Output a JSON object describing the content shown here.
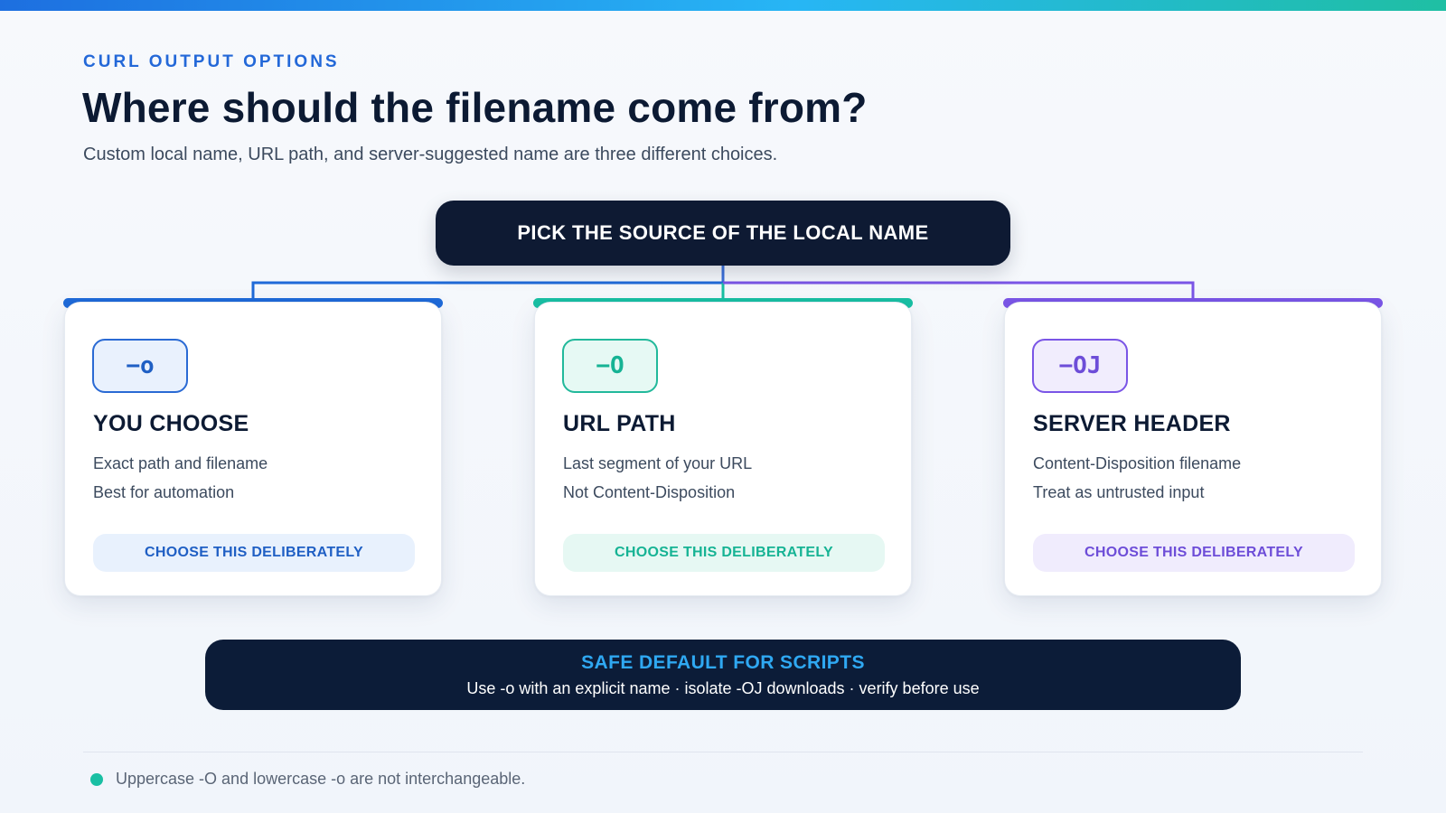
{
  "header": {
    "eyebrow": "CURL OUTPUT OPTIONS",
    "title": "Where should the filename come from?",
    "subtitle": "Custom local name, URL path, and server-suggested name are three different choices."
  },
  "root": {
    "label": "PICK THE SOURCE OF THE LOCAL NAME"
  },
  "cards": [
    {
      "flag": "−o",
      "title": "YOU CHOOSE",
      "lines": [
        "Exact path and filename",
        "Best for automation"
      ],
      "button": "CHOOSE THIS DELIBERATELY",
      "accent": "#1f6ad8",
      "badge_bg": "#e9f1fd",
      "badge_text": "#1f5fc4",
      "button_bg": "#e8f1fd",
      "button_text": "#1f5fc4"
    },
    {
      "flag": "−O",
      "title": "URL PATH",
      "lines": [
        "Last segment of your URL",
        "Not Content-Disposition"
      ],
      "button": "CHOOSE THIS DELIBERATELY",
      "accent": "#19bfa3",
      "badge_bg": "#e6f9f4",
      "badge_text": "#16b394",
      "button_bg": "#e6f8f3",
      "button_text": "#16b394"
    },
    {
      "flag": "−OJ",
      "title": "SERVER HEADER",
      "lines": [
        "Content-Disposition filename",
        "Treat as untrusted input"
      ],
      "button": "CHOOSE THIS DELIBERATELY",
      "accent": "#7a55e6",
      "badge_bg": "#f1edfd",
      "badge_text": "#6d4dd8",
      "button_bg": "#f0ecfd",
      "button_text": "#6d4dd8"
    }
  ],
  "default_box": {
    "title": "SAFE DEFAULT FOR SCRIPTS",
    "text": "Use -o with an explicit name · isolate -OJ downloads · verify before use"
  },
  "footnote": {
    "text": "Uppercase -O and lowercase -o are not interchangeable.",
    "dot_color": "#19bfa3"
  },
  "colors": {
    "top_bar": [
      "#1d6fe0",
      "#27b6f5",
      "#1fbfa3"
    ],
    "dark": "#0e1a33",
    "eyebrow": "#2368d8",
    "default_title": "#2fa8f2"
  }
}
